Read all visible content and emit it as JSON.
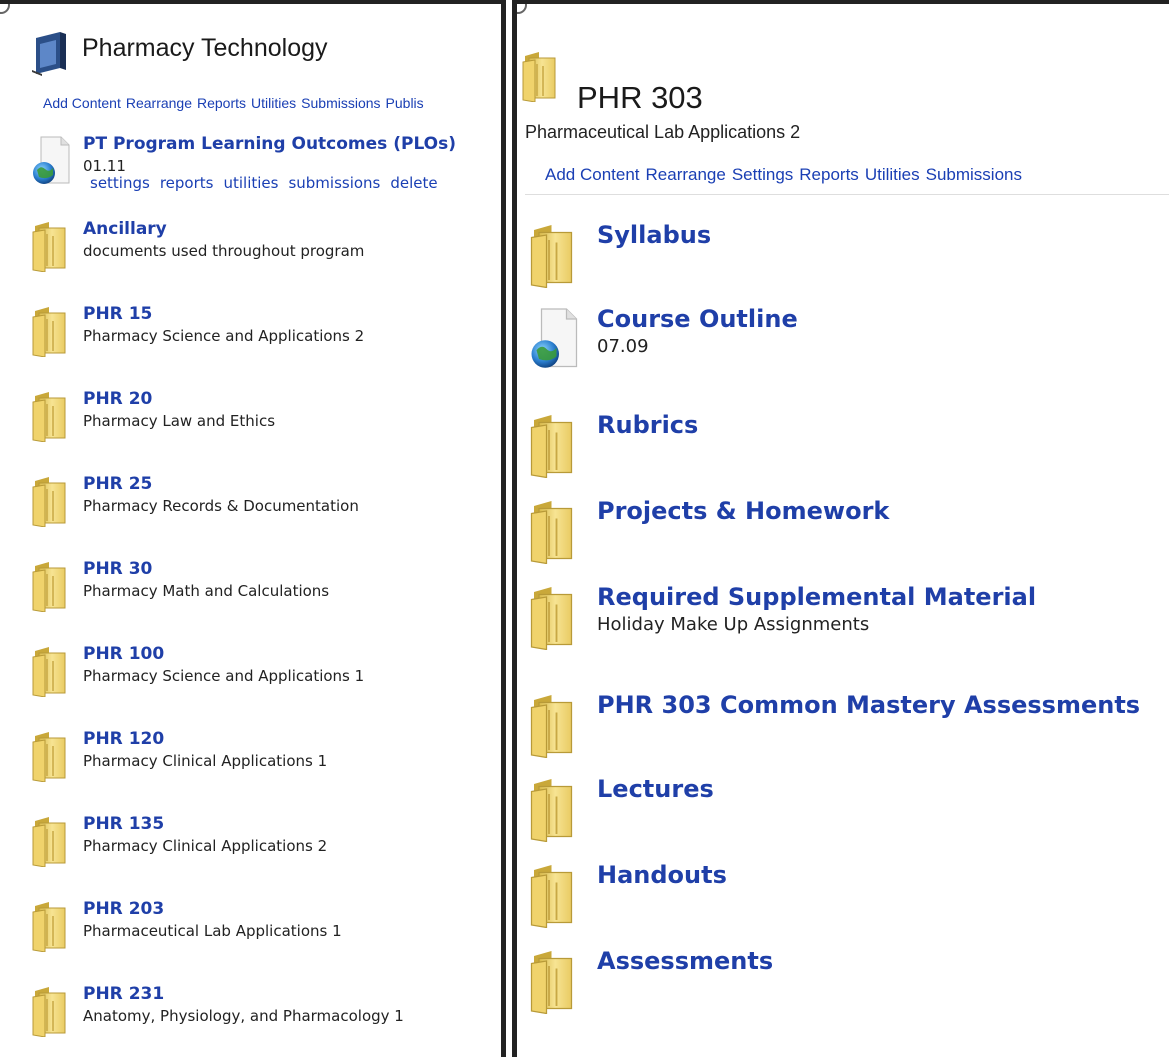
{
  "left": {
    "title": "Pharmacy Technology",
    "actions": [
      "Add Content",
      "Rearrange",
      "Reports",
      "Utilities",
      "Submissions",
      "Publis"
    ],
    "document": {
      "title": "PT Program Learning Outcomes (PLOs)",
      "subtitle": "01.11",
      "actions": [
        "settings",
        "reports",
        "utilities",
        "submissions",
        "delete"
      ]
    },
    "folders": [
      {
        "title": "Ancillary",
        "subtitle": "documents used throughout program"
      },
      {
        "title": "PHR 15",
        "subtitle": "Pharmacy Science and Applications 2"
      },
      {
        "title": "PHR 20",
        "subtitle": "Pharmacy Law and Ethics"
      },
      {
        "title": "PHR 25",
        "subtitle": "Pharmacy Records & Documentation"
      },
      {
        "title": "PHR 30",
        "subtitle": "Pharmacy Math and Calculations"
      },
      {
        "title": "PHR 100",
        "subtitle": "Pharmacy Science and Applications 1"
      },
      {
        "title": "PHR 120",
        "subtitle": "Pharmacy Clinical Applications 1"
      },
      {
        "title": "PHR 135",
        "subtitle": "Pharmacy Clinical Applications 2"
      },
      {
        "title": "PHR 203",
        "subtitle": "Pharmaceutical Lab Applications 1"
      },
      {
        "title": "PHR 231",
        "subtitle": "Anatomy, Physiology, and Pharmacology 1"
      }
    ]
  },
  "right": {
    "title": "PHR 303",
    "subtitle": "Pharmaceutical Lab Applications 2",
    "actions": [
      "Add Content",
      "Rearrange",
      "Settings",
      "Reports",
      "Utilities",
      "Submissions"
    ],
    "items": [
      {
        "type": "folder",
        "title": "Syllabus",
        "subtitle": ""
      },
      {
        "type": "document",
        "title": "Course Outline",
        "subtitle": "07.09"
      },
      {
        "type": "folder",
        "title": "Rubrics",
        "subtitle": ""
      },
      {
        "type": "folder",
        "title": "Projects & Homework",
        "subtitle": ""
      },
      {
        "type": "folder",
        "title": "Required Supplemental Material",
        "subtitle": "Holiday Make Up Assignments"
      },
      {
        "type": "folder",
        "title": "PHR 303 Common Mastery Assessments",
        "subtitle": ""
      },
      {
        "type": "folder",
        "title": "Lectures",
        "subtitle": ""
      },
      {
        "type": "folder",
        "title": "Handouts",
        "subtitle": ""
      },
      {
        "type": "folder",
        "title": "Assessments",
        "subtitle": ""
      }
    ]
  },
  "icons": {
    "folder": "folder-icon",
    "document": "web-document-icon",
    "book": "book-icon"
  },
  "colors": {
    "link": "#1a3fb4",
    "item_title": "#1f3fa8",
    "folder_fill": "#f3da74",
    "pane_border": "#222222"
  }
}
